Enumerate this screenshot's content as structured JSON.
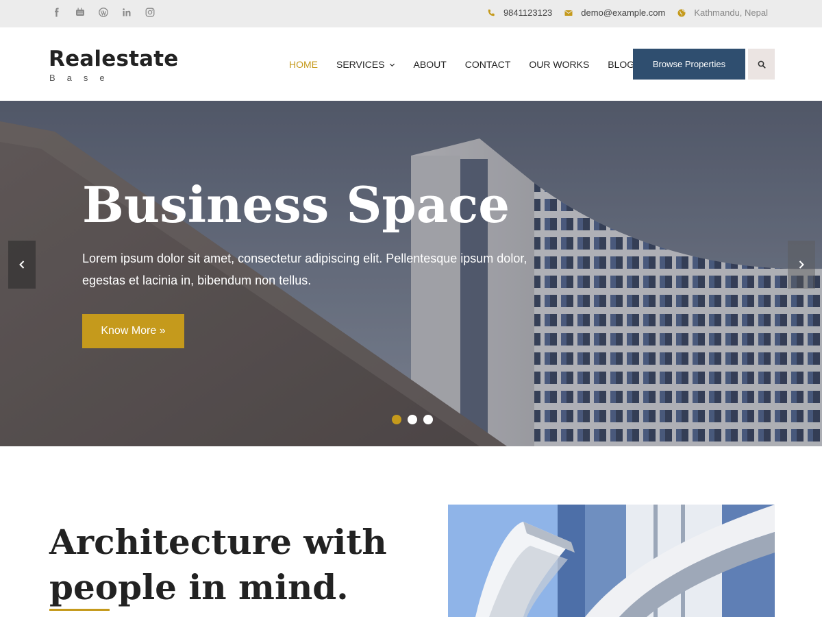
{
  "topbar": {
    "social_icons": [
      "facebook-icon",
      "youtube-icon",
      "wordpress-icon",
      "linkedin-icon",
      "instagram-icon"
    ],
    "phone": "9841123123",
    "email": "demo@example.com",
    "location": "Kathmandu, Nepal"
  },
  "header": {
    "logo_title": "Realestate",
    "logo_sub": "Base",
    "nav": [
      {
        "label": "HOME",
        "active": true
      },
      {
        "label": "SERVICES",
        "has_dropdown": true
      },
      {
        "label": "ABOUT"
      },
      {
        "label": "CONTACT"
      },
      {
        "label": "OUR WORKS"
      },
      {
        "label": "BLOG"
      }
    ],
    "browse_label": "Browse Properties"
  },
  "hero": {
    "title": "Business Space",
    "text": "Lorem ipsum dolor sit amet, consectetur adipiscing elit. Pellentesque ipsum dolor, egestas et lacinia in, bibendum non tellus.",
    "button": "Know More »",
    "slide_count": 3,
    "active_slide": 1
  },
  "about": {
    "title": "Architecture with people in mind."
  },
  "colors": {
    "accent": "#c59a1c",
    "primary": "#2f4e6f",
    "topbar_bg": "#ececec"
  }
}
